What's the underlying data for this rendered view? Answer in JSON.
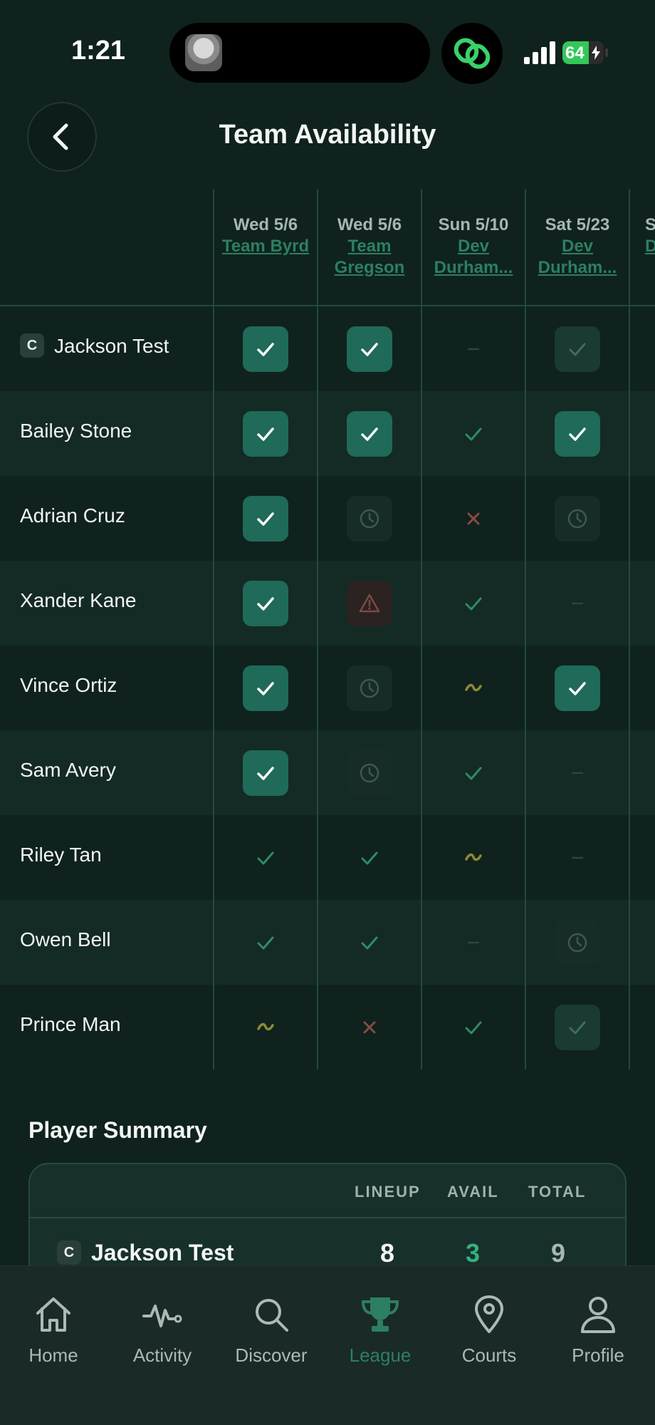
{
  "status_bar": {
    "time": "1:21",
    "battery": "64",
    "battery_level": 0.64
  },
  "header": {
    "title": "Team Availability"
  },
  "columns": [
    {
      "date": "Wed 5/6",
      "opponent": "Team Byrd"
    },
    {
      "date": "Wed 5/6",
      "opponent": "Team Gregson"
    },
    {
      "date": "Sun 5/10",
      "opponent": "Dev Durham..."
    },
    {
      "date": "Sat 5/23",
      "opponent": "Dev Durham..."
    },
    {
      "date": "S",
      "opponent": "D"
    }
  ],
  "players": [
    {
      "name": "Jackson Test",
      "captain": "C",
      "status": [
        "lineup",
        "lineup",
        "none",
        "available-boxed"
      ]
    },
    {
      "name": "Bailey Stone",
      "captain": "",
      "status": [
        "lineup",
        "lineup",
        "available",
        "lineup"
      ]
    },
    {
      "name": "Adrian Cruz",
      "captain": "",
      "status": [
        "lineup",
        "pending",
        "unavailable",
        "pending"
      ]
    },
    {
      "name": "Xander Kane",
      "captain": "",
      "status": [
        "lineup",
        "warning",
        "available",
        "none"
      ]
    },
    {
      "name": "Vince Ortiz",
      "captain": "",
      "status": [
        "lineup",
        "pending",
        "maybe",
        "lineup"
      ]
    },
    {
      "name": "Sam Avery",
      "captain": "",
      "status": [
        "lineup",
        "pending",
        "available",
        "none"
      ]
    },
    {
      "name": "Riley Tan",
      "captain": "",
      "status": [
        "available",
        "available",
        "maybe",
        "none"
      ]
    },
    {
      "name": "Owen Bell",
      "captain": "",
      "status": [
        "available",
        "available",
        "none",
        "pending"
      ]
    },
    {
      "name": "Prince Man",
      "captain": "",
      "status": [
        "maybe",
        "unavailable",
        "available",
        "available-boxed"
      ]
    }
  ],
  "summary": {
    "title": "Player Summary",
    "headers": {
      "lineup": "LINEUP",
      "avail": "AVAIL",
      "total": "TOTAL"
    },
    "rows": [
      {
        "captain": "C",
        "name": "Jackson Test",
        "lineup": "8",
        "avail": "3",
        "total": "9"
      }
    ]
  },
  "tabs": [
    {
      "label": "Home",
      "icon": "home-icon"
    },
    {
      "label": "Activity",
      "icon": "activity-icon"
    },
    {
      "label": "Discover",
      "icon": "search-icon"
    },
    {
      "label": "League",
      "icon": "trophy-icon",
      "active": true
    },
    {
      "label": "Courts",
      "icon": "location-pin-icon"
    },
    {
      "label": "Profile",
      "icon": "person-icon"
    }
  ],
  "colors": {
    "background": "#0f221e",
    "accent": "#2c7f63",
    "lineup_fill": "#1f6a58",
    "unavailable": "#8a4a44",
    "maybe": "#8d8a36"
  }
}
